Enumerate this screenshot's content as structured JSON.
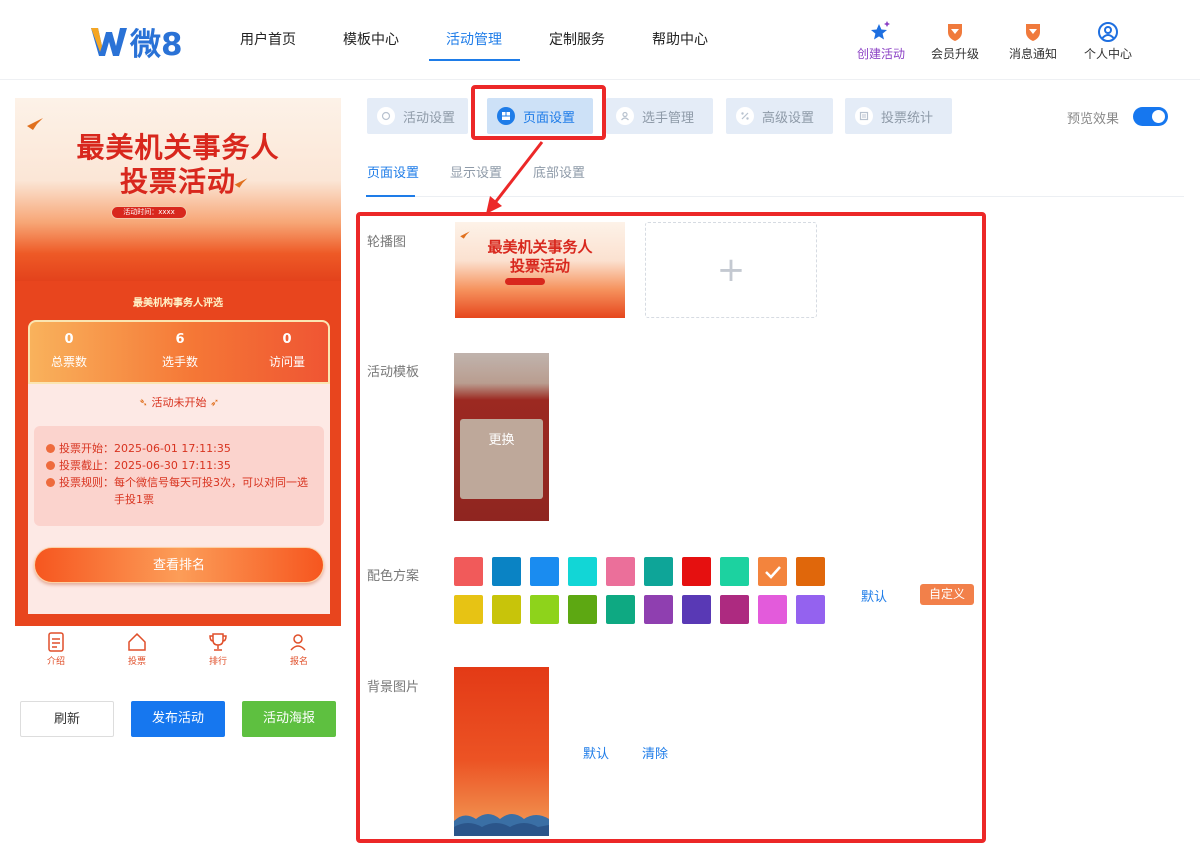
{
  "header": {
    "logo_text": "微8",
    "nav": [
      "用户首页",
      "模板中心",
      "活动管理",
      "定制服务",
      "帮助中心"
    ],
    "right_nav": {
      "create": "创建活动",
      "upgrade": "会员升级",
      "notify": "消息通知",
      "profile": "个人中心"
    }
  },
  "preview": {
    "banner_line1": "最美机关事务人",
    "banner_line2": "投票活动",
    "banner_time": "活动时间：xxxx",
    "subtitle": "最美机构事务人评选",
    "stats": [
      {
        "value": "0",
        "label": "总票数"
      },
      {
        "value": "6",
        "label": "选手数"
      },
      {
        "value": "0",
        "label": "访问量"
      }
    ],
    "status": "活动未开始",
    "info": [
      {
        "label": "投票开始：",
        "text": "2025-06-01 17:11:35"
      },
      {
        "label": "投票截止：",
        "text": "2025-06-30 17:11:35"
      },
      {
        "label": "投票规则：",
        "text": "每个微信号每天可投3次，可以对同一选手投1票"
      }
    ],
    "rank_button": "查看排名",
    "tabbar": [
      "介绍",
      "投票",
      "排行",
      "报名"
    ]
  },
  "actions": {
    "refresh": "刷新",
    "publish": "发布活动",
    "poster": "活动海报"
  },
  "settings_tabs": [
    "活动设置",
    "页面设置",
    "选手管理",
    "高级设置",
    "投票统计"
  ],
  "preview_toggle": {
    "label": "预览效果",
    "on": true
  },
  "subtabs": [
    "页面设置",
    "显示设置",
    "底部设置"
  ],
  "form": {
    "carousel_label": "轮播图",
    "carousel_slide_line1": "最美机关事务人",
    "carousel_slide_line2": "投票活动",
    "add_symbol": "+",
    "template_label": "活动模板",
    "template_change": "更换",
    "color_label": "配色方案",
    "colors": [
      "#f15a5a",
      "#0a83c4",
      "#1a8cf0",
      "#12d6d6",
      "#eb6f9a",
      "#0ea598",
      "#e51010",
      "#1cd2a0",
      "#f3843d",
      "#e0670b",
      "#e7c314",
      "#c8c40a",
      "#8ed31b",
      "#5da812",
      "#0ea982",
      "#8f3fb0",
      "#5939b5",
      "#ad2a80",
      "#e35bdb",
      "#9462ef"
    ],
    "selected_color_index": 8,
    "color_default": "默认",
    "color_custom": "自定义",
    "bg_label": "背景图片",
    "bg_default": "默认",
    "bg_clear": "清除"
  }
}
